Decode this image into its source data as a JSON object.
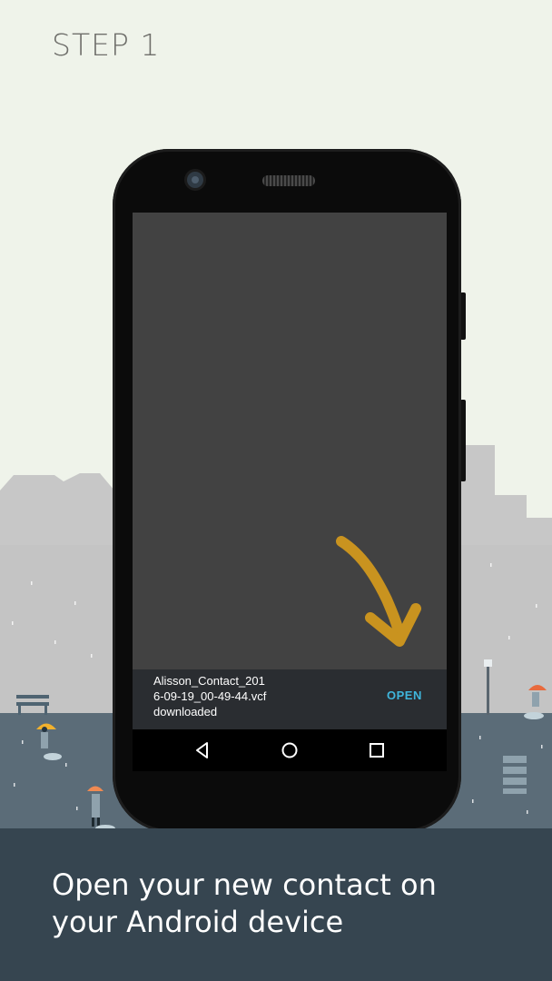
{
  "step_title": "STEP 1",
  "notification": {
    "filename_line1": "Alisson_Contact_201",
    "filename_line2": "6-09-19_00-49-44.vcf",
    "status": "downloaded",
    "action_label": "OPEN"
  },
  "caption": {
    "line1": "Open your new contact on",
    "line2": "your Android device"
  },
  "nav_icons": [
    "back-icon",
    "home-icon",
    "recents-icon"
  ],
  "colors": {
    "background": "#eff3ea",
    "bottom_panel": "#364550",
    "accent_open": "#3fb6dc",
    "arrow": "#c9931f"
  }
}
